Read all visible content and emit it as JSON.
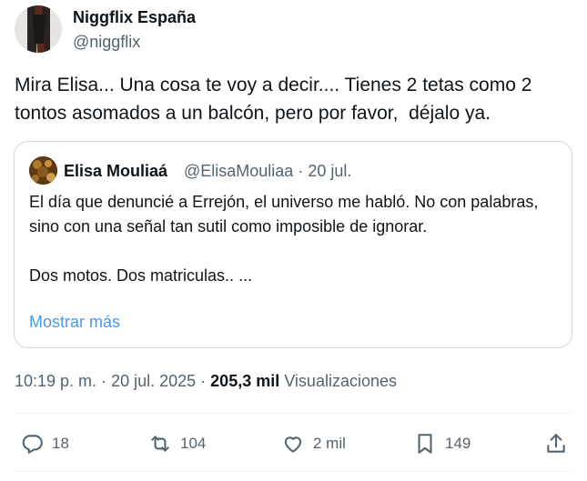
{
  "author": {
    "name": "Niggflix España",
    "handle": "@niggflix",
    "avatar_icon": "profile-avatar"
  },
  "tweet": {
    "text": "Mira Elisa... Una cosa te voy a decir.... Tienes 2 tetas como 2 tontos asomados a un balcón, pero por favor,  déjalo ya."
  },
  "quote": {
    "name": "Elisa Mouliaá",
    "handle_date": "@ElisaMouliaa · 20 jul.",
    "text": "El día que denuncié a Errejón, el universo me habló. No con palabras, sino con una señal tan sutil como imposible de ignorar.\n\nDos motos. Dos matriculas.. ...",
    "show_more": "Mostrar más",
    "avatar_icon": "profile-avatar"
  },
  "meta": {
    "time": "10:19 p. m.",
    "date": "20 jul. 2025",
    "views_count": "205,3 mil",
    "views_label": "Visualizaciones"
  },
  "actions": {
    "replies": "18",
    "retweets": "104",
    "likes": "2 mil",
    "bookmarks": "149"
  },
  "colors": {
    "text": "#0f1419",
    "secondary": "#536471",
    "link": "#4a99e9",
    "border": "#cfd9de",
    "divider": "#eff3f4"
  }
}
